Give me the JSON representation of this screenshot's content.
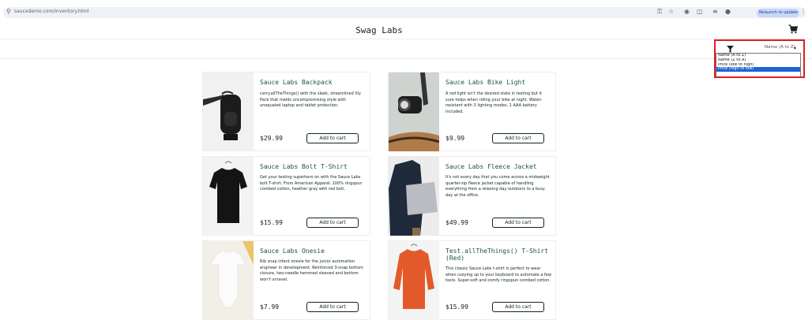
{
  "browser": {
    "url": "saucedemo.com/inventory.html",
    "relaunch_label": "Relaunch to update",
    "relaunch_menu": "⋮"
  },
  "app": {
    "logo": "Swag Labs"
  },
  "sort": {
    "selected": "Name (A to Z)",
    "options": [
      "Name (A to Z)",
      "Name (Z to A)",
      "Price (low to high)",
      "Price (high to low)"
    ],
    "highlighted_option": "Price (high to low)"
  },
  "products": [
    {
      "title": "Sauce Labs Backpack",
      "description": "carry.allTheThings() with the sleek, streamlined Sly Pack that melds uncompromising style with unequaled laptop and tablet protection.",
      "price": "$29.99",
      "button": "Add to cart"
    },
    {
      "title": "Sauce Labs Bike Light",
      "description": "A red light isn't the desired state in testing but it sure helps when riding your bike at night. Water-resistant with 3 lighting modes, 1 AAA battery included.",
      "price": "$9.99",
      "button": "Add to cart"
    },
    {
      "title": "Sauce Labs Bolt T-Shirt",
      "description": "Get your testing superhero on with the Sauce Labs bolt T-shirt. From American Apparel, 100% ringspun combed cotton, heather gray with red bolt.",
      "price": "$15.99",
      "button": "Add to cart"
    },
    {
      "title": "Sauce Labs Fleece Jacket",
      "description": "It's not every day that you come across a midweight quarter-zip fleece jacket capable of handling everything from a relaxing day outdoors to a busy day at the office.",
      "price": "$49.99",
      "button": "Add to cart"
    },
    {
      "title": "Sauce Labs Onesie",
      "description": "Rib snap infant onesie for the junior automation engineer in development. Reinforced 3-snap bottom closure, two-needle hemmed sleeved and bottom won't unravel.",
      "price": "$7.99",
      "button": "Add to cart"
    },
    {
      "title": "Test.allTheThings() T-Shirt (Red)",
      "description": "This classic Sauce Labs t-shirt is perfect to wear when cozying up to your keyboard to automate a few tests. Super-soft and comfy ringspun combed cotton.",
      "price": "$15.99",
      "button": "Add to cart"
    }
  ]
}
